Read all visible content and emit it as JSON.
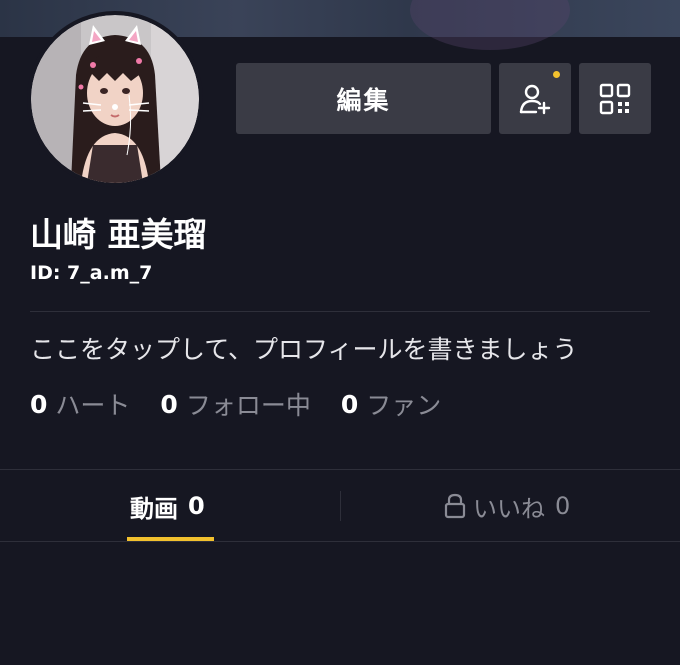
{
  "profile": {
    "name": "山崎 亜美瑠",
    "id": "ID: 7_a.m_7",
    "bio": "ここをタップして、プロフィールを書きましょう"
  },
  "actions": {
    "edit_label": "編集",
    "add_friend_icon": "add-user-icon",
    "qr_icon": "qr-code-icon",
    "notification_dot_color": "#f2c12e"
  },
  "stats": [
    {
      "value": "0",
      "label": "ハート"
    },
    {
      "value": "0",
      "label": "フォロー中"
    },
    {
      "value": "0",
      "label": "ファン"
    }
  ],
  "tabs": {
    "videos": {
      "label": "動画",
      "count": "0"
    },
    "likes": {
      "label": "いいね",
      "count": "0",
      "icon": "lock-icon"
    }
  },
  "colors": {
    "background": "#161722",
    "accent": "#f2c12e",
    "button": "#3a3b45"
  }
}
